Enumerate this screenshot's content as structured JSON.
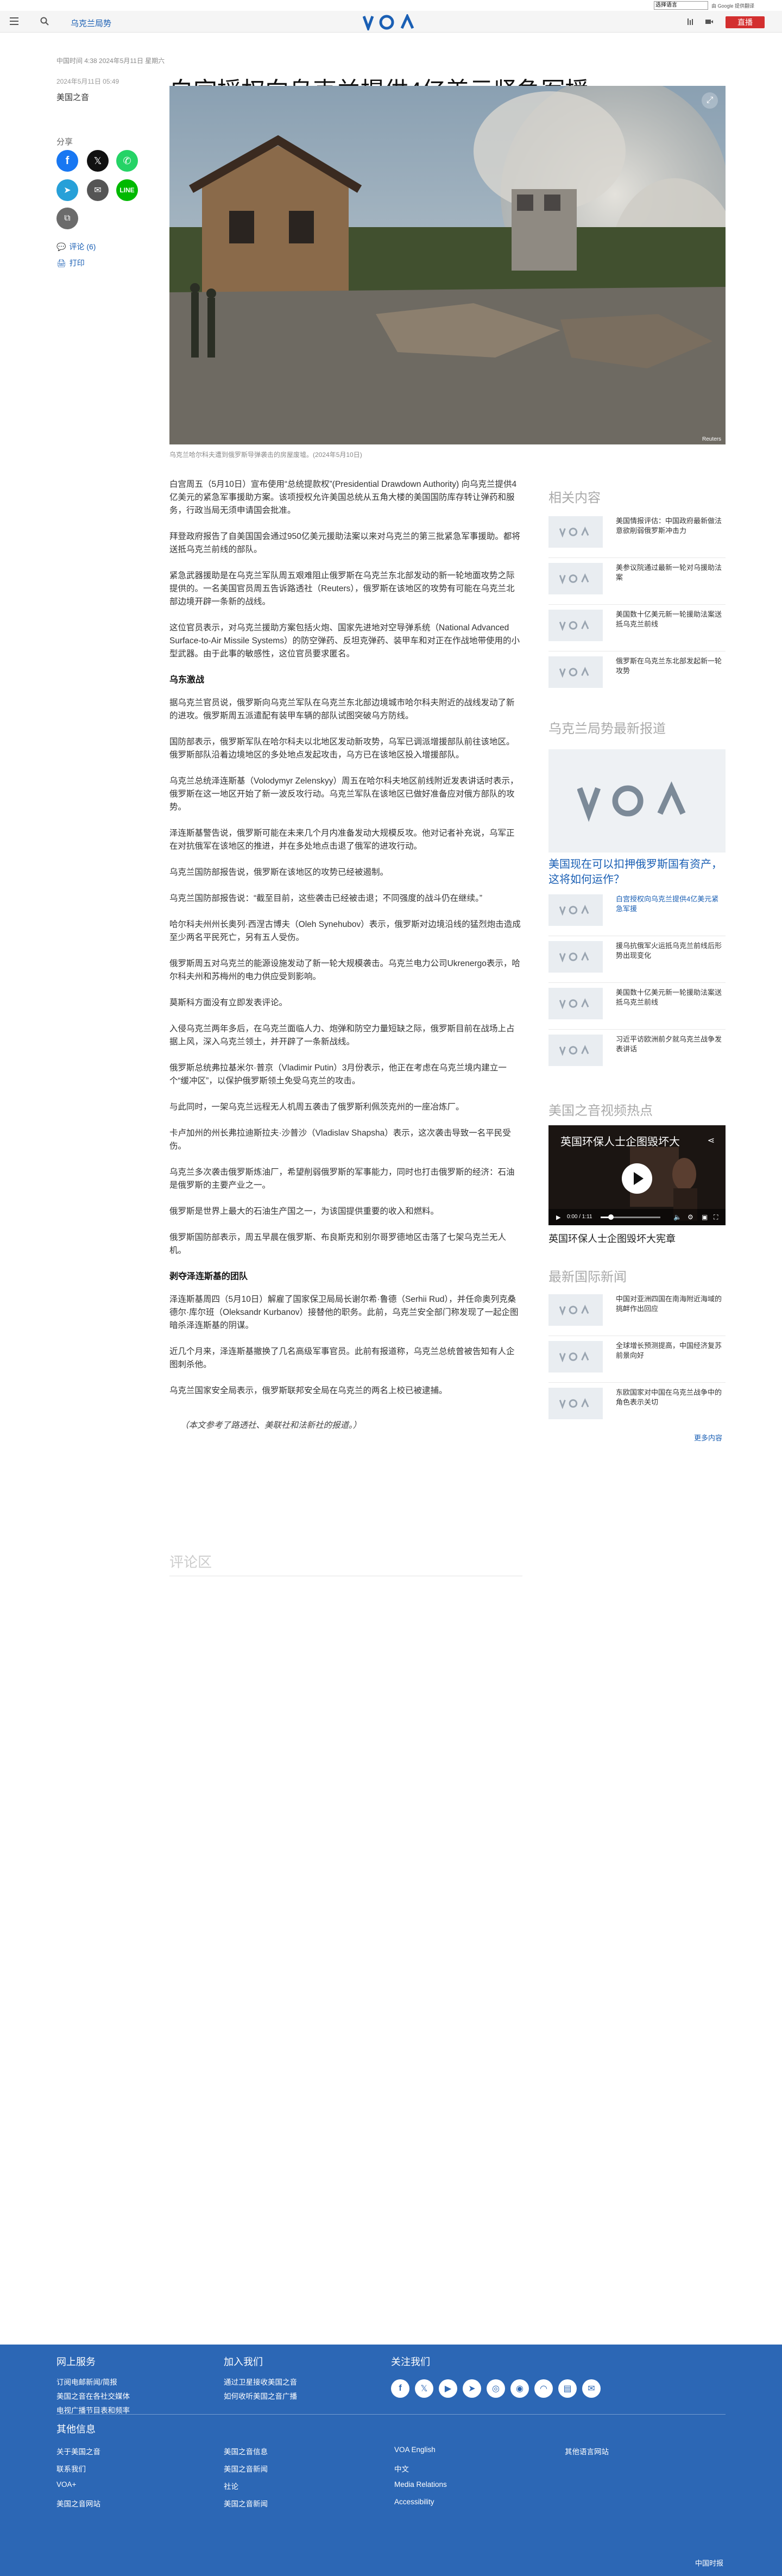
{
  "gtranslate": {
    "select_label": "选择语言",
    "powered": "由 Google 提供翻译"
  },
  "header": {
    "section": "乌克兰局势",
    "live_label": "直播"
  },
  "breadcrumb": "中国时间 4:38 2024年5月11日 星期六",
  "meta": {
    "date": "2024年5月11日 05:49",
    "author": "美国之音"
  },
  "headline": "白宫授权向乌克兰提供4亿美元紧急军援",
  "share": {
    "label": "分享",
    "comments": "评论 (6)",
    "print": "打印"
  },
  "hero": {
    "credit": "Reuters",
    "caption": "乌克兰哈尔科夫遭到俄罗斯导弹袭击的房屋废墟。(2024年5月10日)"
  },
  "article": {
    "paragraphs_1": [
      "白宫周五（5月10日）宣布使用“总统提款权”(Presidential Drawdown Authority) 向乌克兰提供4亿美元的紧急军事援助方案。该项授权允许美国总统从五角大楼的美国国防库存转让弹药和服务，行政当局无须申请国会批准。",
      "拜登政府报告了自美国国会通过950亿美元援助法案以来对乌克兰的第三批紧急军事援助。都将送抵乌克兰前线的部队。",
      "紧急武器援助是在乌克兰军队周五艰难阻止俄罗斯在乌克兰东北部发动的新一轮地面攻势之际提供的。一名美国官员周五告诉路透社（Reuters），俄罗斯在该地区的攻势有可能在乌克兰北部边境开辟一条新的战线。",
      "这位官员表示，对乌克兰援助方案包括火炮、国家先进地对空导弹系统（National Advanced Surface-to-Air Missile Systems）的防空弹药、反坦克弹药、装甲车和对正在作战地带使用的小型武器。由于此事的敏感性，这位官员要求匿名。"
    ],
    "h1": "乌东激战",
    "paragraphs_2": [
      "据乌克兰官员说，俄罗斯向乌克兰军队在乌克兰东北部边境城市哈尔科夫附近的战线发动了新的进攻。俄罗斯周五派遣配有装甲车辆的部队试图突破乌方防线。",
      "国防部表示，俄罗斯军队在哈尔科夫以北地区发动新攻势，乌军已调派增援部队前往该地区。俄罗斯部队沿着边境地区的多处地点发起攻击，乌方已在该地区投入增援部队。",
      "乌克兰总统泽连斯基（Volodymyr Zelenskyy）周五在哈尔科夫地区前线附近发表讲话时表示，俄罗斯在这一地区开始了新一波反攻行动。乌克兰军队在该地区已做好准备应对俄方部队的攻势。",
      "泽连斯基警告说，俄罗斯可能在未来几个月内准备发动大规模反攻。他对记者补充说，乌军正在对抗俄军在该地区的推进，并在多处地点击退了俄军的进攻行动。",
      "乌克兰国防部报告说，俄罗斯在该地区的攻势已经被遏制。",
      "乌克兰国防部报告说：“截至目前，这些袭击已经被击退；不同强度的战斗仍在继续。”",
      "哈尔科夫州州长奥列·西涅古博夫（Oleh Synehubov）表示，俄罗斯对边境沿线的猛烈炮击造成至少两名平民死亡，另有五人受伤。",
      "俄罗斯周五对乌克兰的能源设施发动了新一轮大规模袭击。乌克兰电力公司Ukrenergo表示，哈尔科夫州和苏梅州的电力供应受到影响。",
      "莫斯科方面没有立即发表评论。",
      "入侵乌克兰两年多后，在乌克兰面临人力、炮弹和防空力量短缺之际，俄罗斯目前在战场上占据上风，深入乌克兰领土，并开辟了一条新战线。",
      "俄罗斯总统弗拉基米尔·普京（Vladimir Putin）3月份表示，他正在考虑在乌克兰境内建立一个“缓冲区”，以保护俄罗斯领土免受乌克兰的攻击。",
      "与此同时，一架乌克兰远程无人机周五袭击了俄罗斯利佩茨克州的一座冶炼厂。",
      "卡卢加州的州长弗拉迪斯拉夫·沙普沙（Vladislav Shapsha）表示，这次袭击导致一名平民受伤。",
      "乌克兰多次袭击俄罗斯炼油厂，希望削弱俄罗斯的军事能力，同时也打击俄罗斯的经济：石油是俄罗斯的主要产业之一。",
      "俄罗斯是世界上最大的石油生产国之一，为该国提供重要的收入和燃料。",
      "俄罗斯国防部表示，周五早晨在俄罗斯、布良斯克和别尔哥罗德地区击落了七架乌克兰无人机。"
    ],
    "h2": "剥夺泽连斯基的团队",
    "paragraphs_3": [
      "泽连斯基周四（5月10日）解雇了国家保卫局局长谢尔希·鲁德（Serhii Rud），并任命奥列克桑德尔·库尔班（Oleksandr Kurbanov）接替他的职务。此前，乌克兰安全部门称发现了一起企图暗杀泽连斯基的阴谋。",
      "近几个月来，泽连斯基撤换了几名高级军事官员。此前有报道称，乌克兰总统曾被告知有人企图刺杀他。",
      "乌克兰国家安全局表示，俄罗斯联邦安全局在乌克兰的两名上校已被逮捕。"
    ],
    "note": "（本文参考了路透社、美联社和法新社的报道。）"
  },
  "comments_title": "评论区",
  "rail": {
    "related_title": "相关内容",
    "related": [
      "美国情报评估：中国政府最新做法意欲削弱俄罗斯冲击力",
      "美参议院通过最新一轮对乌援助法案",
      "美国数十亿美元新一轮援助法案送抵乌克兰前线",
      "俄罗斯在乌克兰东北部发起新一轮攻势"
    ],
    "latest_title": "乌克兰局势最新报道",
    "feature_title": "美国现在可以扣押俄罗斯国有资产，这将如何运作？",
    "latest": [
      "白宫授权向乌克兰提供4亿美元紧急军援",
      "援乌抗俄军火运抵乌克兰前线后形势出现变化",
      "美国数十亿美元新一轮援助法案送抵乌克兰前线",
      "习近平访欧洲前夕就乌克兰战争发表讲话"
    ],
    "video_title": "美国之音视频热点",
    "video_player_title": "英国环保人士企图毁坏大",
    "video_time": "0:00 / 1:11",
    "video_caption": "英国环保人士企图毁坏大宪章",
    "world_title": "最新国际新闻",
    "world": [
      "中国对亚洲四国在南海附近海域的挑衅作出回应",
      "全球增长预测提高，中国经济复苏前景向好",
      "东欧国家对中国在乌克兰战争中的角色表示关切"
    ],
    "more": "更多内容"
  },
  "footer": {
    "col1_title": "网上服务",
    "col1_links": [
      "订阅电邮新闻/简报",
      "美国之音在各社交媒体",
      "电视广播节目表和频率"
    ],
    "col2_title": "加入我们",
    "col2_links": [
      "通过卫星接收美国之音",
      "如何收听美国之音广播"
    ],
    "col3_title": "关注我们",
    "more_title": "其他信息",
    "grid": [
      "关于美国之音",
      "美国之音信息",
      "VOA English",
      "其他语言网站",
      "联系我们",
      "美国之音新闻",
      "中文",
      "",
      "VOA+",
      "社论",
      "Media Relations",
      "",
      "美国之音网站",
      "美国之音新闻",
      "Accessibility",
      ""
    ],
    "logo_text": "中国时报"
  },
  "colors": {
    "brand_blue": "#2c67b5",
    "live_red": "#d32f2f",
    "link_blue": "#1a5fb4"
  }
}
